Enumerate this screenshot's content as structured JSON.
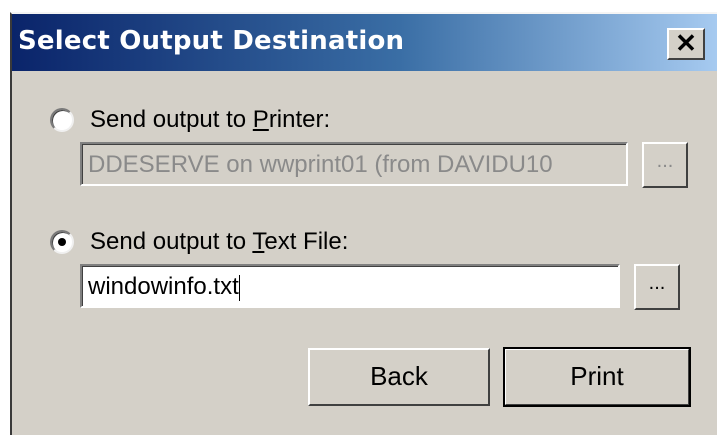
{
  "dialog": {
    "title": "Select Output Destination",
    "close_glyph": "✕"
  },
  "printer_option": {
    "label_before": "Send output to ",
    "label_accel": "P",
    "label_after": "rinter:",
    "checked": false,
    "field_value": "DDESERVE on wwprint01 (from DAVIDU10",
    "browse_label": "..."
  },
  "textfile_option": {
    "label_before": "Send output to ",
    "label_accel": "T",
    "label_after": "ext File:",
    "checked": true,
    "field_value": "windowinfo.txt",
    "browse_label": "..."
  },
  "buttons": {
    "back_label": "Back",
    "print_label": "Print"
  }
}
